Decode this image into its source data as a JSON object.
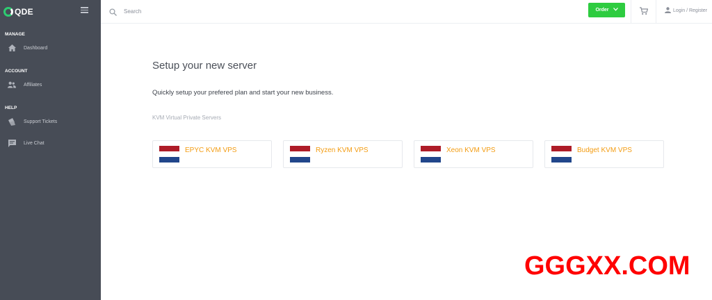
{
  "brand": {
    "name": "QDE"
  },
  "sidebar": {
    "sections": [
      {
        "title": "MANAGE",
        "items": [
          {
            "label": "Dashboard",
            "icon": "home-icon"
          }
        ]
      },
      {
        "title": "ACCOUNT",
        "items": [
          {
            "label": "Affiliates",
            "icon": "users-icon"
          }
        ]
      },
      {
        "title": "HELP",
        "items": [
          {
            "label": "Support Tickets",
            "icon": "tickets-icon"
          },
          {
            "label": "Live Chat",
            "icon": "chat-icon"
          }
        ]
      }
    ]
  },
  "topbar": {
    "search_placeholder": "Search",
    "order_label": "Order",
    "login_label": "Login / Register"
  },
  "main": {
    "title": "Setup your new server",
    "subtitle": "Quickly setup your prefered plan and start your new business.",
    "section_label": "KVM Virtual Private Servers",
    "plans": [
      {
        "label": "EPYC KVM VPS"
      },
      {
        "label": "Ryzen KVM VPS"
      },
      {
        "label": "Xeon KVM VPS"
      },
      {
        "label": "Budget KVM VPS"
      }
    ]
  },
  "watermark": "GGGXX.COM",
  "colors": {
    "sidebar_bg": "#474c56",
    "accent_green": "#2ecc40",
    "plan_orange": "#f39c12",
    "flag_red": "#ae1c28",
    "flag_white": "#ffffff",
    "flag_blue": "#21468b"
  }
}
